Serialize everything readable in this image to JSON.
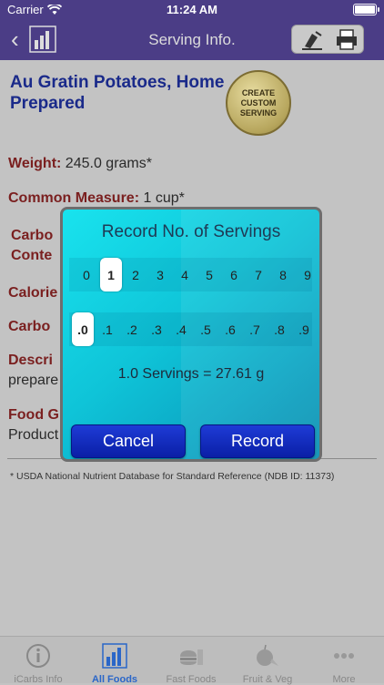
{
  "status_bar": {
    "carrier": "Carrier",
    "time": "11:24 AM"
  },
  "nav": {
    "title": "Serving Info."
  },
  "food": {
    "name": "Au Gratin Potatoes, Home Prepared",
    "custom_button": "CREATE\nCUSTOM\nSERVING"
  },
  "rows": {
    "weight_label": "Weight:",
    "weight_value": " 245.0 grams*",
    "measure_label": "Common Measure:",
    "measure_value": " 1 cup*",
    "carb_content_label_1": "Carbo",
    "carb_content_label_2": "Conte",
    "calories_label": "Calorie",
    "carbs_label": "Carbo",
    "description_label": "Descri",
    "description_value": "prepare",
    "food_group_label": "Food G",
    "food_group_value": "Product"
  },
  "footnote": "* USDA National Nutrient Database for Standard Reference (NDB ID: 11373)",
  "dialog": {
    "title": "Record No. of Servings",
    "whole_digits": [
      "0",
      "1",
      "2",
      "3",
      "4",
      "5",
      "6",
      "7",
      "8",
      "9"
    ],
    "selected_whole": "1",
    "fraction_digits": [
      ".0",
      ".1",
      ".2",
      ".3",
      ".4",
      ".5",
      ".6",
      ".7",
      ".8",
      ".9"
    ],
    "selected_fraction": ".0",
    "result": "1.0 Servings = 27.61 g",
    "cancel_label": "Cancel",
    "record_label": "Record"
  },
  "tabs": [
    {
      "label": "iCarbs Info",
      "icon": "info-icon",
      "active": false
    },
    {
      "label": "All Foods",
      "icon": "bar-chart-icon",
      "active": true
    },
    {
      "label": "Fast Foods",
      "icon": "fast-food-icon",
      "active": false
    },
    {
      "label": "Fruit & Veg",
      "icon": "apple-icon",
      "active": false
    },
    {
      "label": "More",
      "icon": "more-icon",
      "active": false
    }
  ]
}
